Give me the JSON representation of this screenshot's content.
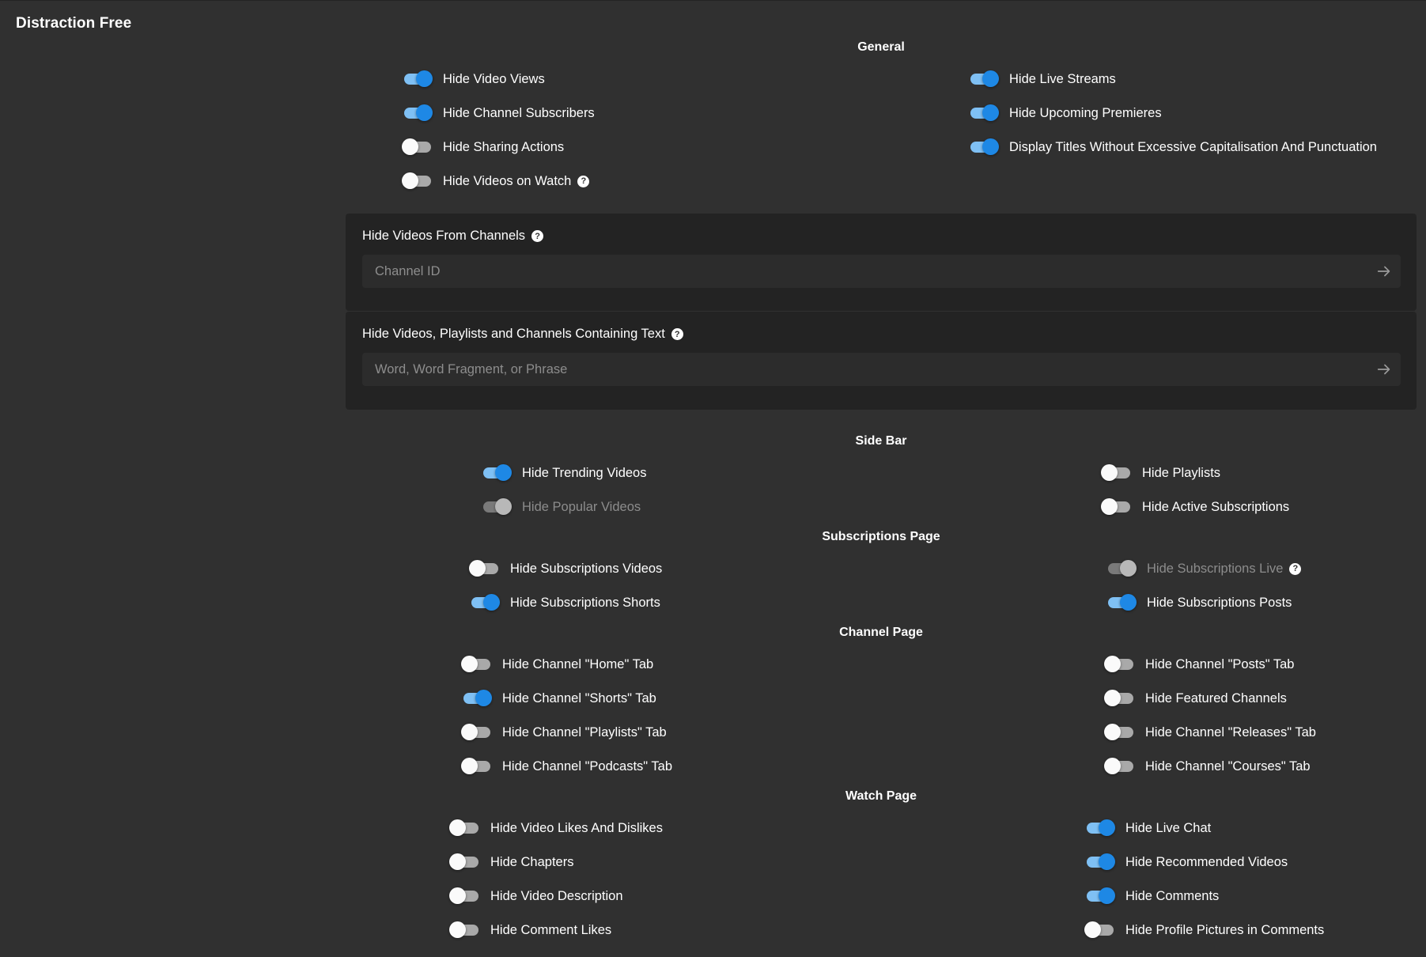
{
  "app_title": "Distraction Free",
  "sections": {
    "general": {
      "heading": "General",
      "left": [
        {
          "label": "Hide Video Views",
          "on": true
        },
        {
          "label": "Hide Channel Subscribers",
          "on": true
        },
        {
          "label": "Hide Sharing Actions",
          "on": false
        },
        {
          "label": "Hide Videos on Watch",
          "on": false,
          "help": "?"
        }
      ],
      "right": [
        {
          "label": "Hide Live Streams",
          "on": true
        },
        {
          "label": "Hide Upcoming Premieres",
          "on": true
        },
        {
          "label": "Display Titles Without Excessive Capitalisation And Punctuation",
          "on": true
        }
      ]
    },
    "channel_filter": {
      "label": "Hide Videos From Channels",
      "help": "?",
      "placeholder": "Channel ID"
    },
    "text_filter": {
      "label": "Hide Videos, Playlists and Channels Containing Text",
      "help": "?",
      "placeholder": "Word, Word Fragment, or Phrase"
    },
    "side_bar": {
      "heading": "Side Bar",
      "left": [
        {
          "label": "Hide Trending Videos",
          "on": true
        },
        {
          "label": "Hide Popular Videos",
          "on": true,
          "disabled": true
        }
      ],
      "right": [
        {
          "label": "Hide Playlists",
          "on": false
        },
        {
          "label": "Hide Active Subscriptions",
          "on": false
        }
      ]
    },
    "subscriptions_page": {
      "heading": "Subscriptions Page",
      "left": [
        {
          "label": "Hide Subscriptions Videos",
          "on": false
        },
        {
          "label": "Hide Subscriptions Shorts",
          "on": true
        }
      ],
      "right": [
        {
          "label": "Hide Subscriptions Live",
          "on": true,
          "disabled": true,
          "help": "?"
        },
        {
          "label": "Hide Subscriptions Posts",
          "on": true
        }
      ]
    },
    "channel_page": {
      "heading": "Channel Page",
      "left": [
        {
          "label": "Hide Channel \"Home\" Tab",
          "on": false
        },
        {
          "label": "Hide Channel \"Shorts\" Tab",
          "on": true
        },
        {
          "label": "Hide Channel \"Playlists\" Tab",
          "on": false
        },
        {
          "label": "Hide Channel \"Podcasts\" Tab",
          "on": false
        }
      ],
      "right": [
        {
          "label": "Hide Channel \"Posts\" Tab",
          "on": false
        },
        {
          "label": "Hide Featured Channels",
          "on": false
        },
        {
          "label": "Hide Channel \"Releases\" Tab",
          "on": false
        },
        {
          "label": "Hide Channel \"Courses\" Tab",
          "on": false
        }
      ]
    },
    "watch_page": {
      "heading": "Watch Page",
      "left": [
        {
          "label": "Hide Video Likes And Dislikes",
          "on": false
        },
        {
          "label": "Hide Chapters",
          "on": false
        },
        {
          "label": "Hide Video Description",
          "on": false
        },
        {
          "label": "Hide Comment Likes",
          "on": false
        }
      ],
      "right": [
        {
          "label": "Hide Live Chat",
          "on": true
        },
        {
          "label": "Hide Recommended Videos",
          "on": true
        },
        {
          "label": "Hide Comments",
          "on": true
        },
        {
          "label": "Hide Profile Pictures in Comments",
          "on": false
        }
      ]
    }
  },
  "colors": {
    "background": "#303030",
    "panel": "#232323",
    "input": "#2c2c2c",
    "accent": "#1e88e5",
    "accent_track": "#7fc0f4",
    "text": "#ffffff",
    "placeholder": "#8d8d8d"
  }
}
